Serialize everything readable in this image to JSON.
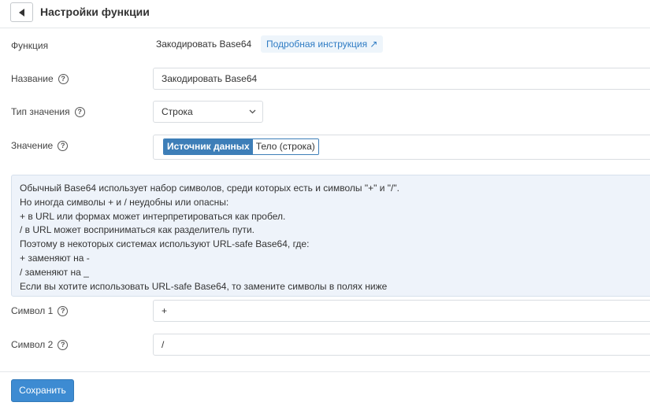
{
  "header": {
    "title": "Настройки функции"
  },
  "rows": {
    "function": {
      "label": "Функция",
      "value": "Закодировать Base64",
      "docs_link": "Подробная инструкция ↗"
    },
    "name": {
      "label": "Название",
      "value": "Закодировать Base64"
    },
    "value_type": {
      "label": "Тип значения",
      "selected": "Строка"
    },
    "value": {
      "label": "Значение",
      "source_tab": "Источник данных",
      "body_tab": "Тело (строка)"
    }
  },
  "info": {
    "lines": [
      "Обычный Base64 использует набор символов, среди которых есть и символы \"+\" и \"/\".",
      "Но иногда символы + и / неудобны или опасны:",
      "+ в URL или формах может интерпретироваться как пробел.",
      "/ в URL может восприниматься как разделитель пути.",
      "Поэтому в некоторых системах используют URL-safe Base64, где:",
      "+ заменяют на -",
      "/ заменяют на _",
      "Если вы хотите использовать URL-safe Base64, то замените символы в полях ниже"
    ]
  },
  "symbols": {
    "symbol1": {
      "label": "Символ 1",
      "value": "+"
    },
    "symbol2": {
      "label": "Символ 2",
      "value": "/"
    }
  },
  "footer": {
    "save_label": "Сохранить"
  },
  "icons": {
    "back": "arrow-left-icon",
    "help": "question-circle-icon",
    "select": "chevron-down-icon"
  },
  "colors": {
    "accent": "#3d8bd2",
    "link": "#2f7cc4",
    "info_bg": "#eef3fa"
  }
}
